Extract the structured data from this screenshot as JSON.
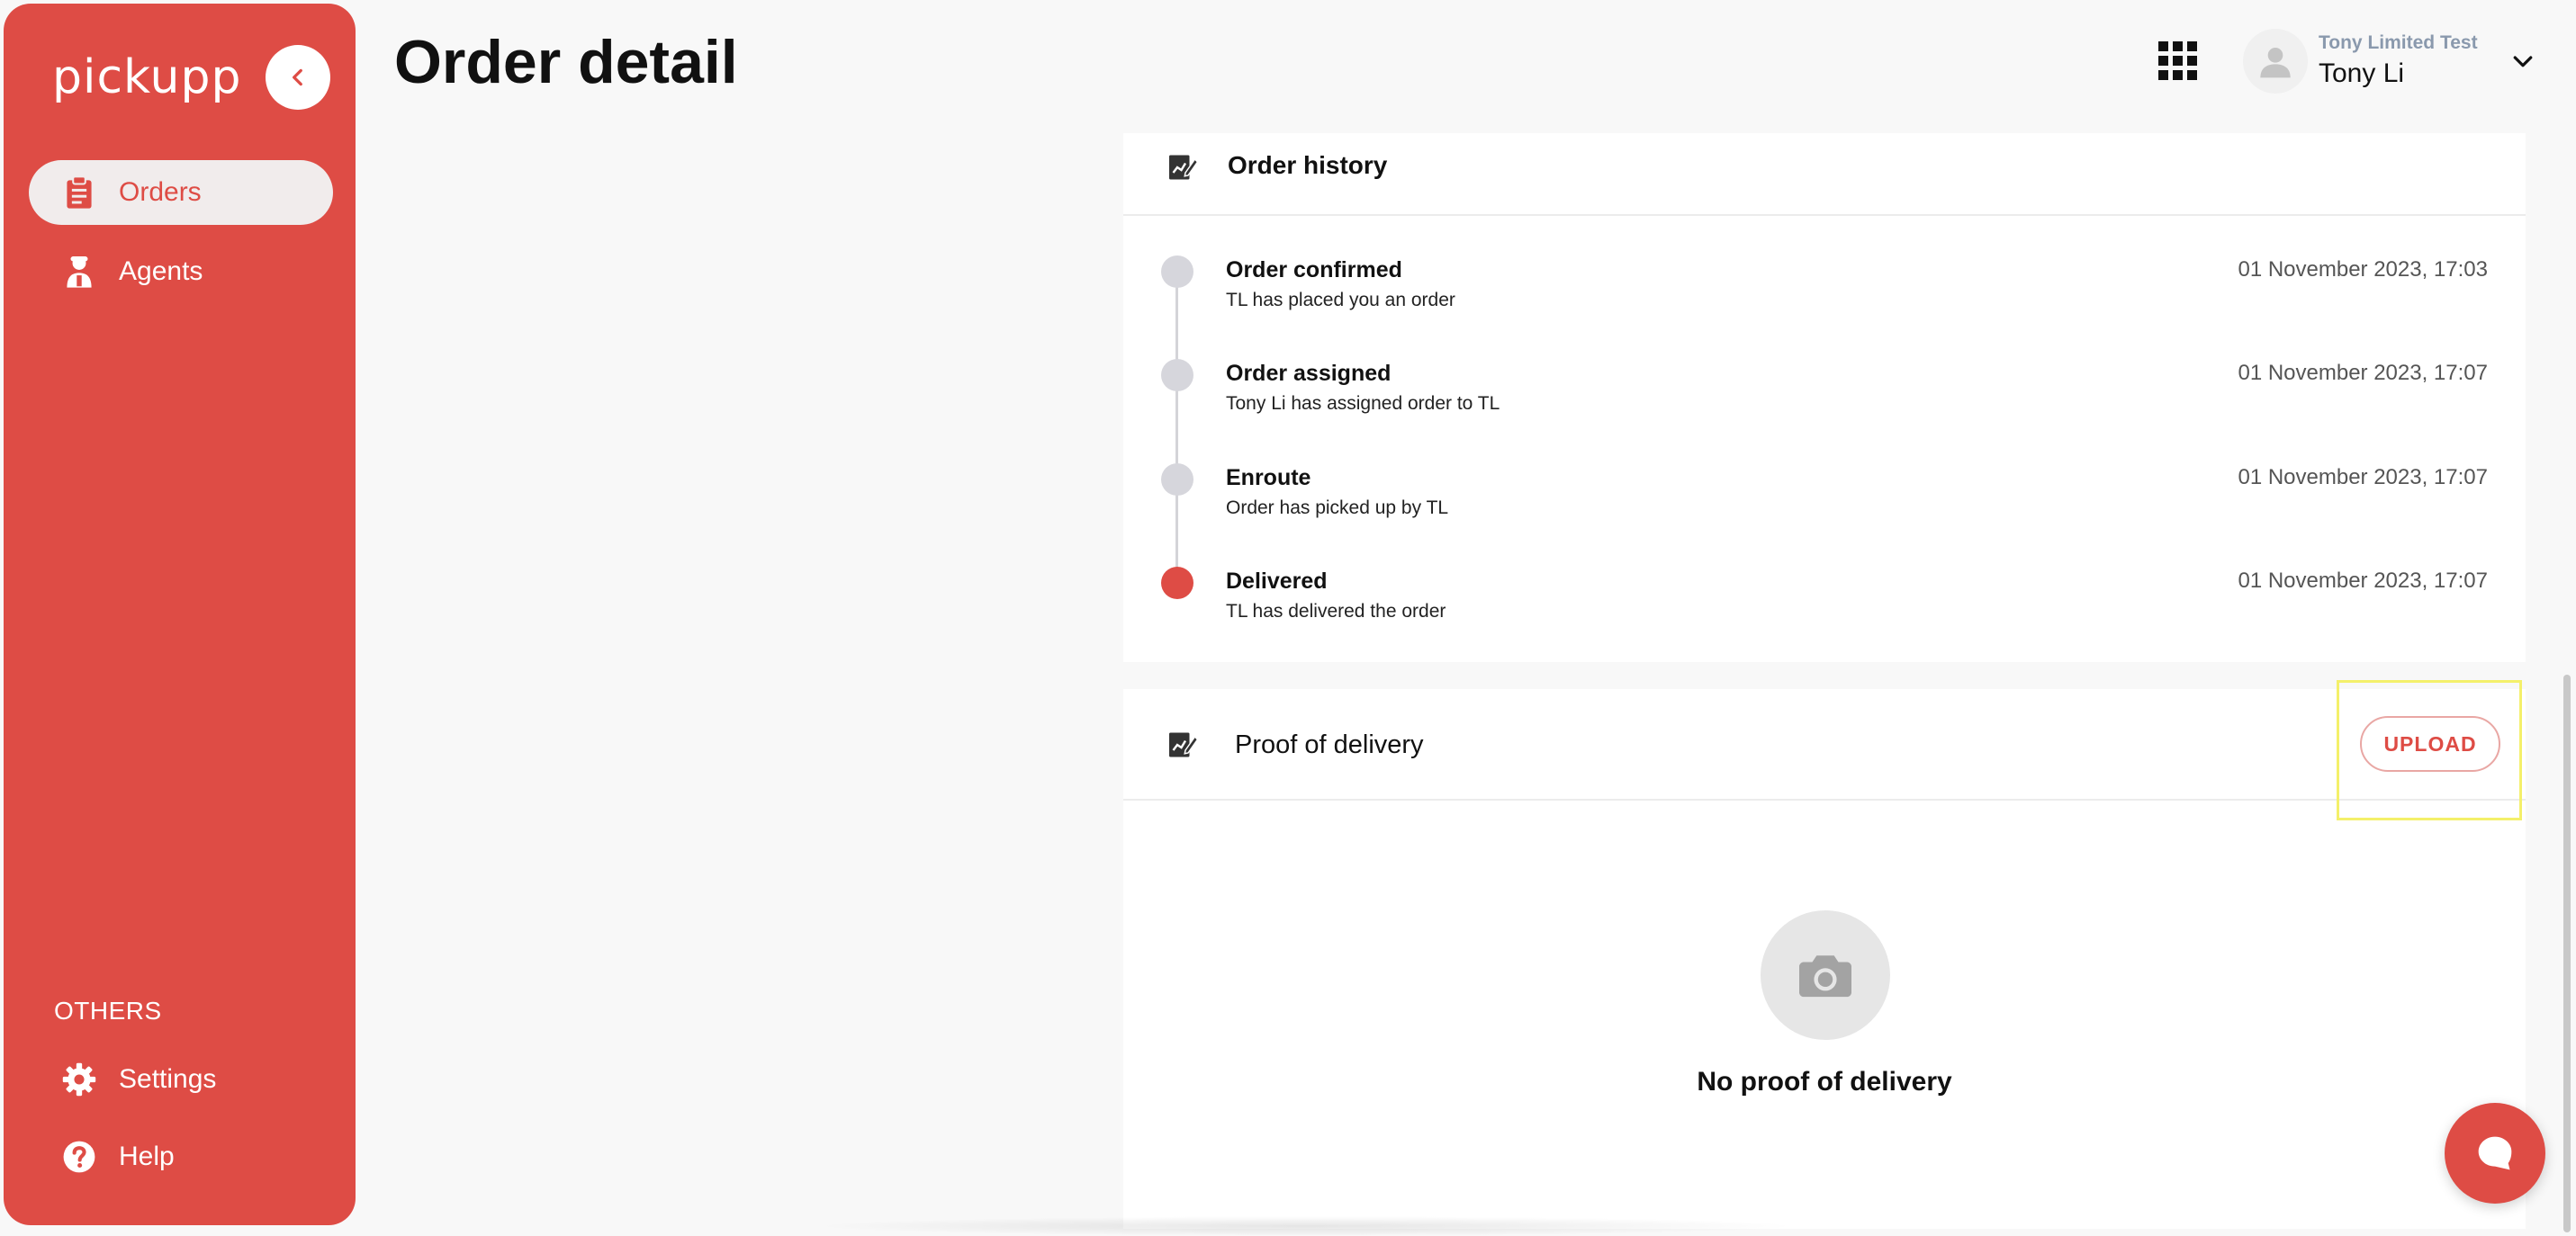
{
  "sidebar": {
    "brand": "pickupp",
    "items": [
      {
        "label": "Orders",
        "icon": "clipboard-icon",
        "active": true
      },
      {
        "label": "Agents",
        "icon": "agent-icon",
        "active": false
      }
    ],
    "section_label": "OTHERS",
    "bottom_items": [
      {
        "label": "Settings",
        "icon": "gear-icon"
      },
      {
        "label": "Help",
        "icon": "help-icon"
      }
    ]
  },
  "header": {
    "title": "Order detail",
    "org_name": "Tony Limited Test",
    "user_name": "Tony Li"
  },
  "order_history": {
    "title": "Order history",
    "events": [
      {
        "title": "Order confirmed",
        "description": "TL has placed you an order",
        "time": "01 November 2023, 17:03",
        "status": "past"
      },
      {
        "title": "Order assigned",
        "description": "Tony Li has assigned order to TL",
        "time": "01 November 2023, 17:07",
        "status": "past"
      },
      {
        "title": "Enroute",
        "description": "Order has picked up by TL",
        "time": "01 November 2023, 17:07",
        "status": "past"
      },
      {
        "title": "Delivered",
        "description": "TL has delivered the order",
        "time": "01 November 2023, 17:07",
        "status": "current"
      }
    ]
  },
  "proof_of_delivery": {
    "title": "Proof of delivery",
    "upload_label": "UPLOAD",
    "empty_text": "No proof of delivery"
  },
  "colors": {
    "brand": "#de4c45",
    "highlight": "#f4f06a",
    "muted_dot": "#d6d6dc"
  }
}
